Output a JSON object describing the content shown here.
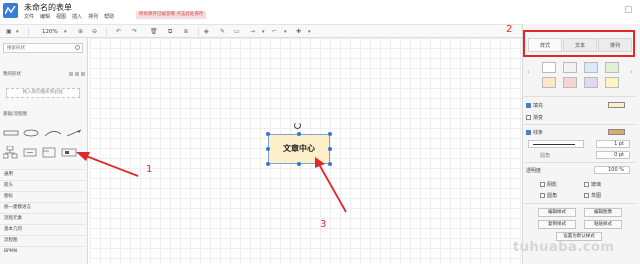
{
  "app": {
    "title": "未命名的表单",
    "menu": [
      "文件",
      "编辑",
      "视图",
      "插入",
      "排列",
      "帮助"
    ],
    "notice": "所有保存已被忽略 点击此处保存"
  },
  "toolbar": {
    "zoom": "120%"
  },
  "sidebar": {
    "search_placeholder": "搜索形状",
    "my_shapes": "我的形状",
    "add_shape": "拖入新的图形到此处",
    "section_basic": "基础/流程图",
    "categories": [
      "通用",
      "箭头",
      "图标",
      "统一建模语言",
      "流程元素",
      "基本几何",
      "流程图",
      "BPMN"
    ]
  },
  "right_panel": {
    "tabs": [
      "样式",
      "文本",
      "排列"
    ],
    "swatch_colors": [
      "#ffffff",
      "#f3f3f3",
      "#dce7f7",
      "#e1f0d8",
      "#fbe9c6",
      "#f6d6d0",
      "#e4d8f0",
      "#fdf6c2",
      "#fce3c8"
    ],
    "fill_label": "填充",
    "gradient_label": "渐变",
    "line_label": "线条",
    "line_width": "1 pt",
    "radius_label": "圆角",
    "radius_value": "0 pt",
    "opacity_label": "透明度",
    "opacity_value": "100 %",
    "checks": [
      "阴影",
      "玻璃",
      "圆角",
      "草图"
    ],
    "buttons": [
      "编辑样式",
      "编辑图像",
      "复制样式",
      "粘贴样式",
      "设置为默认样式"
    ]
  },
  "canvas": {
    "node_text": "文章中心"
  },
  "annotations": [
    "1",
    "2",
    "3"
  ],
  "watermark": "tuhuaba.com",
  "colors": {
    "accent": "#2f78e0",
    "annotation": "#e0282a",
    "node_fill": "#fdf0c8"
  }
}
